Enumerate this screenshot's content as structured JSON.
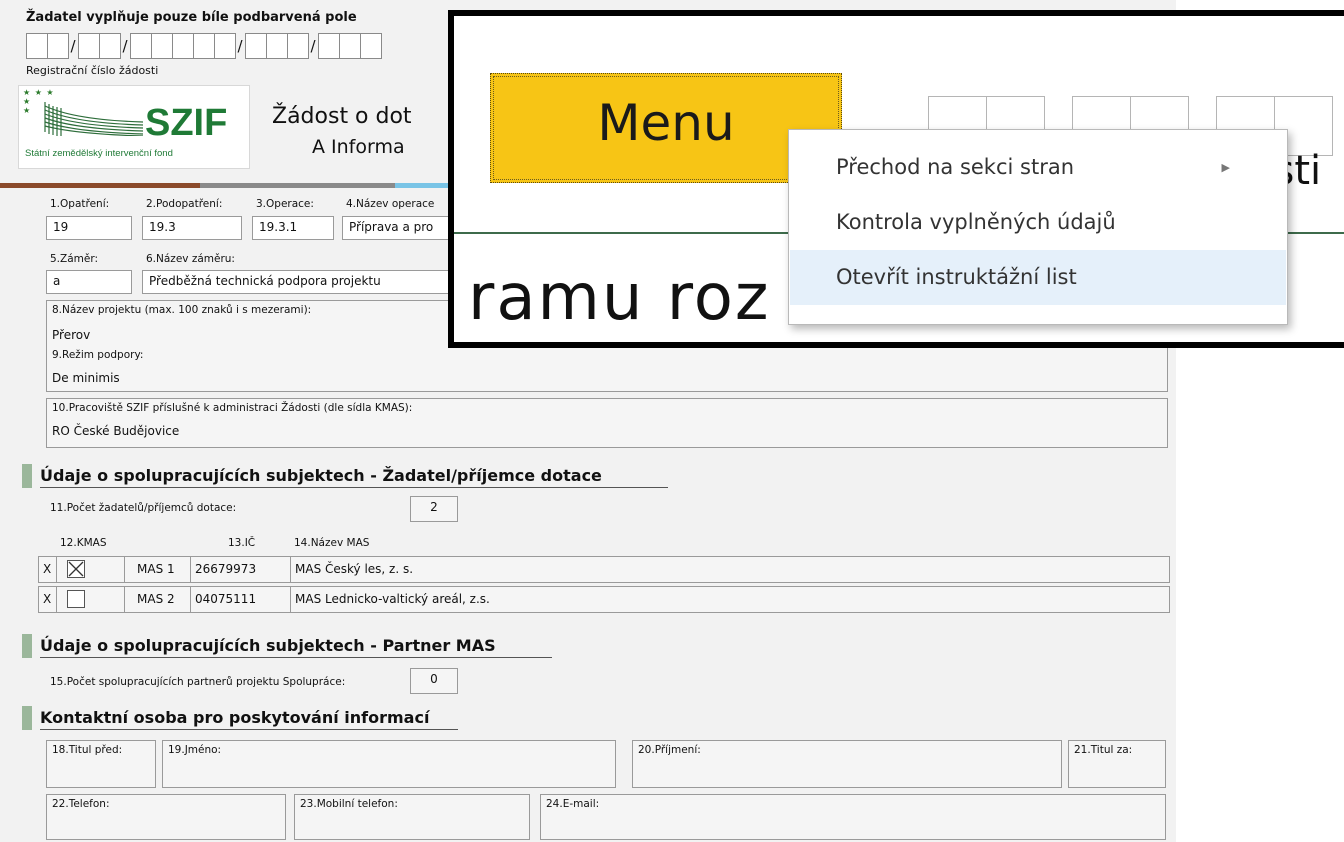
{
  "form": {
    "top_note": "Žadatel vyplňuje pouze bíle podbarvená pole",
    "reg_label": "Registrační číslo žádosti",
    "logo": {
      "brand": "SZIF",
      "subtitle": "Státní zemědělský intervenční fond"
    },
    "title_line1": "Žádost o dot",
    "title_line2": "A Informa",
    "fields": {
      "f1": {
        "label": "1.Opatření:",
        "value": "19"
      },
      "f2": {
        "label": "2.Podopatření:",
        "value": "19.3"
      },
      "f3": {
        "label": "3.Operace:",
        "value": "19.3.1"
      },
      "f4": {
        "label": "4.Název operace",
        "value": "Příprava a pro"
      },
      "f5": {
        "label": "5.Záměr:",
        "value": "a"
      },
      "f6": {
        "label": "6.Název záměru:",
        "value": "Předběžná technická podpora projektu"
      },
      "f8": {
        "label": "8.Název projektu (max. 100 znaků i s mezerami):",
        "value": "Přerov"
      },
      "f9": {
        "label": "9.Režim podpory:",
        "value": "De minimis"
      },
      "f10": {
        "label": "10.Pracoviště SZIF příslušné k administraci Žádosti (dle sídla KMAS):",
        "value": "RO České Budějovice"
      }
    },
    "section1": {
      "title": "Údaje o spolupracujících subjektech - Žadatel/příjemce dotace",
      "count_label": "11.Počet žadatelů/příjemců dotace:",
      "count_value": "2",
      "col_kmas": "12.KMAS",
      "col_ic": "13.IČ",
      "col_name": "14.Název MAS",
      "rows": [
        {
          "del": "X",
          "checked": true,
          "mas": "MAS 1",
          "ic": "26679973",
          "name": "MAS Český les, z. s."
        },
        {
          "del": "X",
          "checked": false,
          "mas": "MAS 2",
          "ic": "04075111",
          "name": "MAS Lednicko-valtický areál, z.s."
        }
      ]
    },
    "section2": {
      "title": "Údaje o spolupracujících subjektech - Partner MAS",
      "count_label": "15.Počet spolupracujících partnerů projektu Spolupráce:",
      "count_value": "0"
    },
    "section3": {
      "title": "Kontaktní osoba pro poskytování informací",
      "f18": "18.Titul před:",
      "f19": "19.Jméno:",
      "f20": "20.Příjmení:",
      "f21": "21.Titul za:",
      "f22": "22.Telefon:",
      "f23": "23.Mobilní telefon:",
      "f24": "24.E-mail:"
    }
  },
  "zoom": {
    "menu_button": "Menu",
    "partial_right": "osti",
    "partial_bottom": "ramu roz",
    "context_menu": [
      {
        "label": "Přechod na sekci stran",
        "has_submenu": true
      },
      {
        "label": "Kontrola vyplněných údajů",
        "has_submenu": false
      },
      {
        "label": "Otevřít instruktážní list",
        "has_submenu": false,
        "highlighted": true
      }
    ]
  },
  "colors": {
    "bar": [
      "#8b4a2b",
      "#8a8a8a",
      "#79c4e6"
    ],
    "brand_green": "#1f7a36",
    "menu_yellow": "#f7c515",
    "highlight": "#e5f0fa"
  }
}
